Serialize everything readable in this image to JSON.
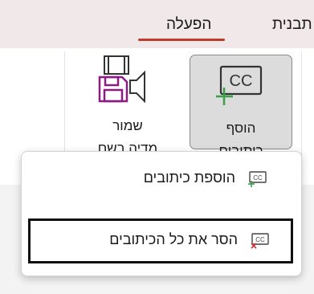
{
  "tabs": {
    "active": "הפעלה",
    "other": "תבנית"
  },
  "ribbon": {
    "save_media": {
      "line1": "שמור",
      "line2": "מדיה בשם"
    },
    "add_captions": {
      "line1": "הוסף",
      "line2": "כיתובים"
    },
    "group_label_fragment": "C"
  },
  "menu": {
    "items": [
      {
        "label": "הוספת כיתובים",
        "icon": "cc-add-icon",
        "highlighted": false
      },
      {
        "label": "הסר את כל הכיתובים",
        "icon": "cc-remove-icon",
        "highlighted": true
      }
    ]
  },
  "colors": {
    "accent": "#c0392b",
    "media_icon": "#8e1a86",
    "add_plus": "#3aa048",
    "remove_x": "#d13438"
  }
}
